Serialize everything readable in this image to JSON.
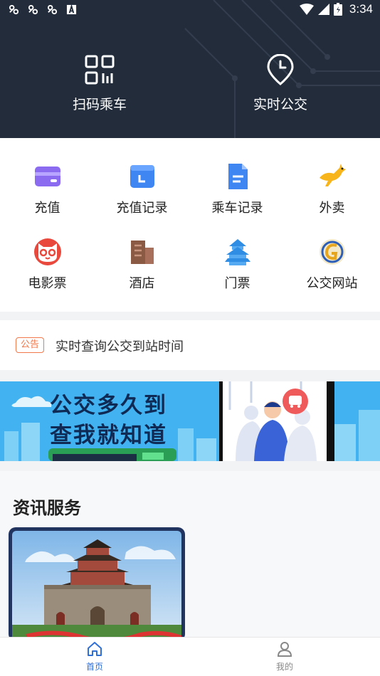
{
  "status_bar": {
    "time": "3:34"
  },
  "header": {
    "scan_label": "扫码乘车",
    "realtime_label": "实时公交"
  },
  "services": [
    {
      "label": "充值",
      "icon": "wallet-icon"
    },
    {
      "label": "充值记录",
      "icon": "calendar-icon"
    },
    {
      "label": "乘车记录",
      "icon": "document-icon"
    },
    {
      "label": "外卖",
      "icon": "kangaroo-icon"
    },
    {
      "label": "电影票",
      "icon": "cat-face-icon"
    },
    {
      "label": "酒店",
      "icon": "building-icon"
    },
    {
      "label": "门票",
      "icon": "temple-icon"
    },
    {
      "label": "公交网站",
      "icon": "bus-logo-icon"
    }
  ],
  "notice": {
    "tag": "公告",
    "text": "实时查询公交到站时间"
  },
  "banner": {
    "line1": "公交多久到",
    "line2": "查我就知道"
  },
  "news": {
    "title": "资讯服务"
  },
  "tabbar": {
    "home": "首页",
    "mine": "我的"
  },
  "colors": {
    "header_bg": "#222c3b",
    "accent": "#2f6fd6",
    "notice_tag": "#f0784a"
  }
}
